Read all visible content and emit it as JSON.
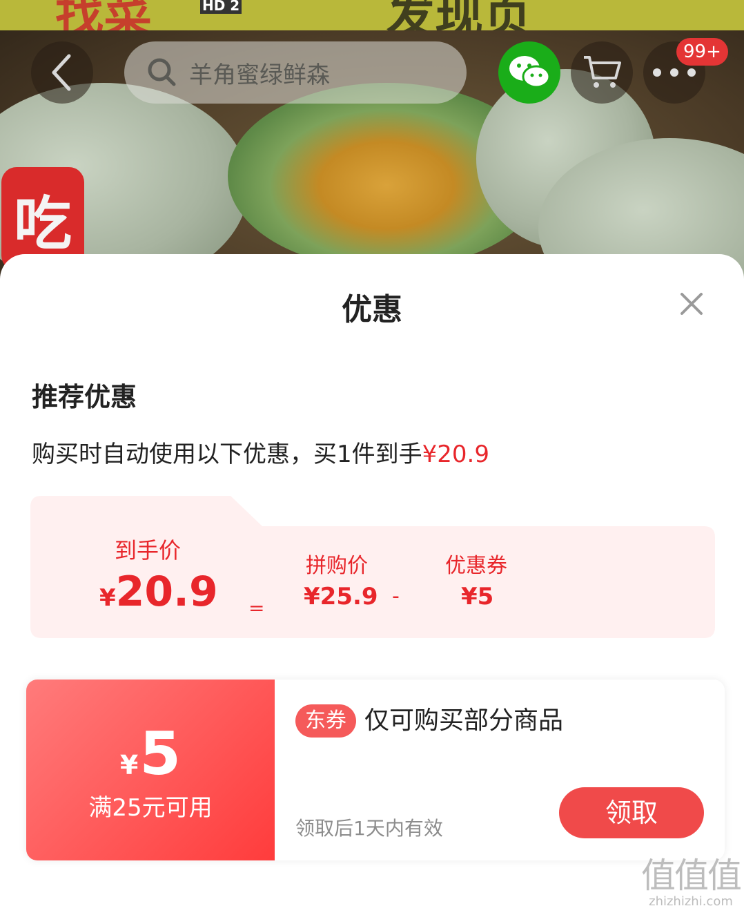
{
  "background": {
    "banner_left_text": "找菜",
    "banner_right_text": "发现页",
    "status_hd": "HD 2",
    "side_badge": "吃",
    "cart_badge": "99+"
  },
  "topbar": {
    "search_placeholder": "羊角蜜绿鲜森"
  },
  "sheet": {
    "title": "优惠",
    "section_title": "推荐优惠",
    "description_prefix": "购买时自动使用以下优惠，买1件到手",
    "description_price": "¥20.9"
  },
  "price_breakdown": {
    "final_label": "到手价",
    "final_currency": "¥",
    "final_value": "20.9",
    "equals": "=",
    "group_label": "拼购价",
    "group_value": "¥25.9",
    "minus": "-",
    "coupon_label": "优惠券",
    "coupon_value": "¥5"
  },
  "coupon": {
    "currency": "¥",
    "amount": "5",
    "condition": "满25元可用",
    "tag": "东券",
    "scope": "仅可购买部分商品",
    "validity": "领取后1天内有效",
    "claim_label": "领取"
  },
  "watermark": {
    "main": "值值值",
    "sub": "zhizhizhi.com"
  },
  "colors": {
    "accent_red": "#e8262b",
    "wechat_green": "#1aad19",
    "card_pink": "#fff0f0"
  }
}
